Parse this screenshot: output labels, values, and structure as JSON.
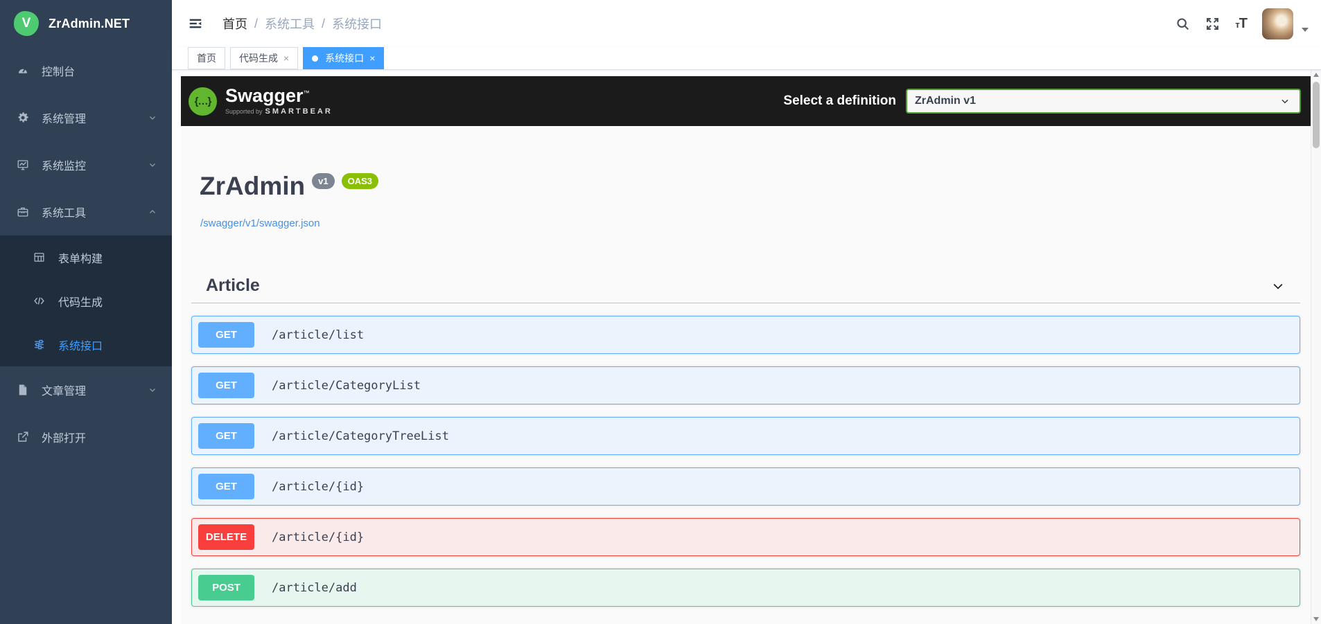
{
  "colors": {
    "accent": "#409eff",
    "sidebar_bg": "#304156",
    "submenu_bg": "#1f2d3d",
    "topbar_bg": "#1b1b1b",
    "method_get": "#61affe",
    "method_delete": "#f93e3e",
    "method_post": "#49cc90",
    "oas_badge": "#89bf04",
    "version_badge": "#7d8492",
    "link": "#4990e2"
  },
  "sidebar": {
    "logo": "ZrAdmin.NET",
    "logo_letter": "V",
    "items": [
      {
        "label": "控制台"
      },
      {
        "label": "系统管理"
      },
      {
        "label": "系统监控"
      },
      {
        "label": "系统工具"
      },
      {
        "label": "文章管理"
      },
      {
        "label": "外部打开"
      }
    ],
    "tools_submenu": [
      {
        "label": "表单构建"
      },
      {
        "label": "代码生成"
      },
      {
        "label": "系统接口"
      }
    ]
  },
  "navbar": {
    "breadcrumb": {
      "items": [
        "首页",
        "系统工具",
        "系统接口"
      ],
      "separator": "/"
    },
    "font_size_icon_small": "т",
    "font_size_icon_large": "T"
  },
  "tabs": {
    "close_glyph": "×",
    "items": [
      {
        "label": "首页"
      },
      {
        "label": "代码生成"
      },
      {
        "label": "系统接口"
      }
    ]
  },
  "swagger": {
    "topbar": {
      "logo_glyph": "{…}",
      "logo_text": "Swagger",
      "tm": "™",
      "supported_by": "Supported by",
      "smartbear": "SMARTBEAR",
      "select_label": "Select a definition",
      "selected_definition": "ZrAdmin v1"
    },
    "info": {
      "title": "ZrAdmin",
      "version_badge": "v1",
      "oas_badge": "OAS3",
      "spec_url": "/swagger/v1/swagger.json"
    },
    "section": {
      "title": "Article"
    },
    "endpoints": [
      {
        "method": "GET",
        "path": "/article/list"
      },
      {
        "method": "GET",
        "path": "/article/CategoryList"
      },
      {
        "method": "GET",
        "path": "/article/CategoryTreeList"
      },
      {
        "method": "GET",
        "path": "/article/{id}"
      },
      {
        "method": "DELETE",
        "path": "/article/{id}"
      },
      {
        "method": "POST",
        "path": "/article/add"
      }
    ]
  }
}
